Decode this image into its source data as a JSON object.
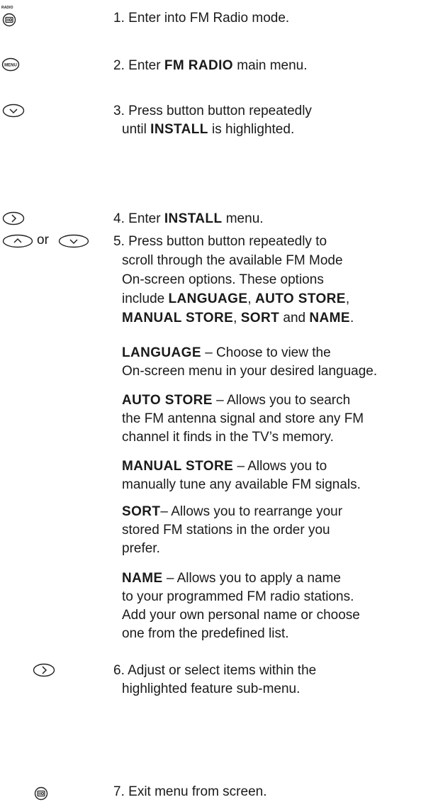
{
  "icons": {
    "radio_caption": "RADIO",
    "menu_caption": "MENU",
    "or_text": "or"
  },
  "steps": [
    {
      "num": "1.",
      "text": "Enter into FM Radio mode."
    },
    {
      "num": "2.",
      "pre": "Enter ",
      "bold": "FM RADIO",
      "post": " main menu."
    },
    {
      "num": "3.",
      "line1": "Press button button repeatedly",
      "line2_pre": "until ",
      "line2_bold": "INSTALL",
      "line2_post": " is highlighted."
    },
    {
      "num": "4.",
      "pre": "Enter ",
      "bold": "INSTALL",
      "post": " menu."
    },
    {
      "num": "5.",
      "line1": "Press button button repeatedly to",
      "line2": "scroll through the available FM Mode",
      "line3": "On-screen options. These options",
      "line4_pre": "include ",
      "line4_b1": "LANGUAGE",
      "line4_sep": ", ",
      "line4_b2": "AUTO STORE",
      "line4_post": ",",
      "line5_b1": "MANUAL STORE",
      "line5_sep1": ", ",
      "line5_b2": "SORT",
      "line5_sep2": " and ",
      "line5_b3": "NAME",
      "line5_post": "."
    },
    {
      "num": "6.",
      "line1": "Adjust or select items within the",
      "line2": "highlighted feature sub-menu."
    },
    {
      "num": "7.",
      "text": "Exit menu from screen."
    }
  ],
  "options": [
    {
      "name": "LANGUAGE",
      "sep": " – ",
      "l1": "Choose to view the",
      "l2": "On-screen menu in your desired language."
    },
    {
      "name": "AUTO STORE",
      "sep": " –  ",
      "l1": "Allows you to search",
      "l2": "the FM antenna signal and store any FM",
      "l3": "channel it finds in the TV’s memory."
    },
    {
      "name": "MANUAL STORE",
      "sep": " –  ",
      "l1": "Allows you to",
      "l2": "manually tune any available FM signals."
    },
    {
      "name": "SORT",
      "sep": "– ",
      "l1": "Allows you to rearrange your",
      "l2": "stored FM stations in the order you",
      "l3": "prefer."
    },
    {
      "name": "NAME",
      "sep": " – ",
      "l1": "Allows you to apply a name",
      "l2": "to your programmed FM radio stations.",
      "l3": "Add your own personal name or choose",
      "l4": "one from the predefined list."
    }
  ]
}
